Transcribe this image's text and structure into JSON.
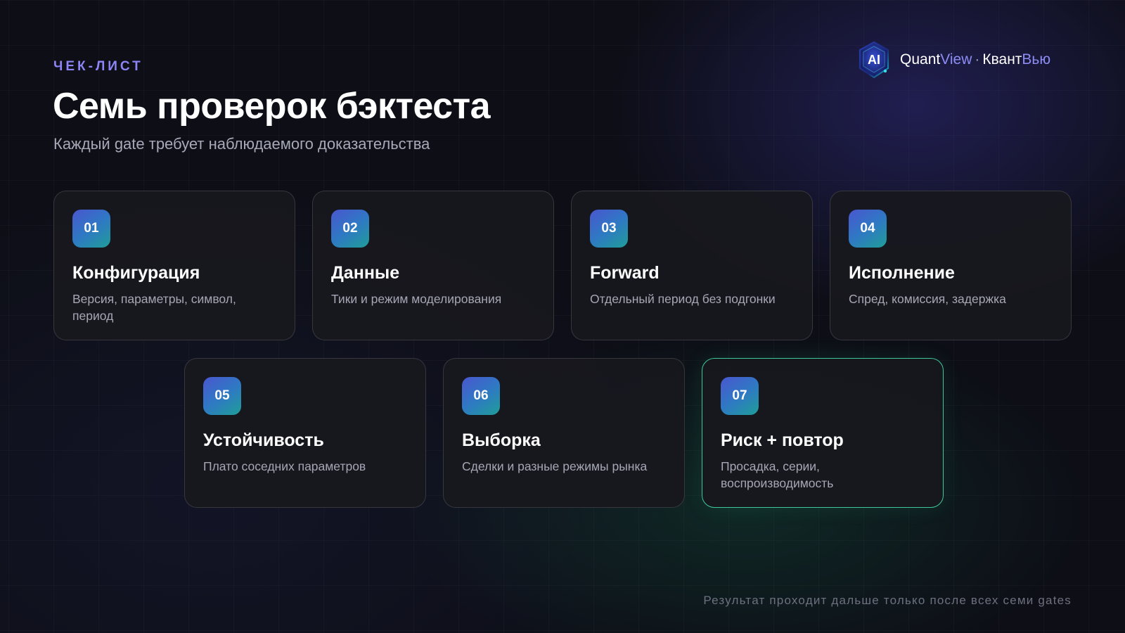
{
  "header": {
    "eyebrow": "ЧЕК-ЛИСТ",
    "title": "Семь проверок бэктеста",
    "subtitle": "Каждый gate требует наблюдаемого доказательства"
  },
  "brand": {
    "logo_text": "AI",
    "name_part1": "Quant",
    "name_part2": "View",
    "separator": "·",
    "name_part3": "Квант",
    "name_part4": "Вью"
  },
  "cards": [
    {
      "num": "01",
      "title": "Конфигурация",
      "desc": "Версия, параметры, символ, период"
    },
    {
      "num": "02",
      "title": "Данные",
      "desc": "Тики и режим моделирования"
    },
    {
      "num": "03",
      "title": "Forward",
      "desc": "Отдельный период без подгонки"
    },
    {
      "num": "04",
      "title": "Исполнение",
      "desc": "Спред, комиссия, задержка"
    },
    {
      "num": "05",
      "title": "Устойчивость",
      "desc": "Плато соседних параметров"
    },
    {
      "num": "06",
      "title": "Выборка",
      "desc": "Сделки и разные режимы рынка"
    },
    {
      "num": "07",
      "title": "Риск + повтор",
      "desc": "Просадка, серии, воспроизводимость"
    }
  ],
  "footer": {
    "note": "Результат проходит дальше только после всех семи gates"
  },
  "colors": {
    "accent": "#8d84f5",
    "highlight_border": "#3fc79a",
    "badge_gradient": [
      "#4a56cf",
      "#1f9e98"
    ]
  }
}
